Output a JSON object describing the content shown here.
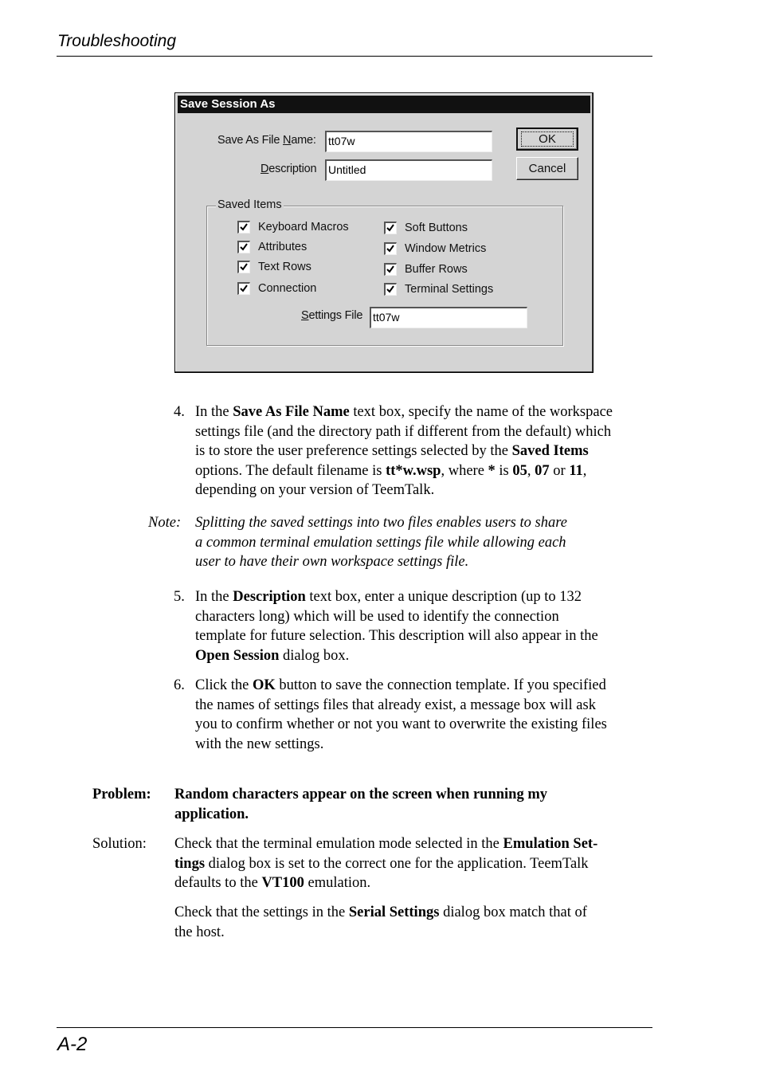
{
  "header": {
    "running_title": "Troubleshooting"
  },
  "footer": {
    "page_number": "A-2"
  },
  "dialog": {
    "title": "Save Session As",
    "file_name_label_pre": "Save As File ",
    "file_name_label_ul": "N",
    "file_name_label_post": "ame:",
    "file_name_value": "tt07w",
    "description_label_ul": "D",
    "description_label_post": "escription",
    "description_value": "Untitled",
    "ok_label": "OK",
    "cancel_label": "Cancel",
    "saved_items_legend": "Saved Items",
    "checkboxes": [
      {
        "label": "Keyboard Macros",
        "checked": true
      },
      {
        "label": "Attributes",
        "checked": true
      },
      {
        "label": "Text Rows",
        "checked": true
      },
      {
        "label": "Connection",
        "checked": true
      },
      {
        "label": "Soft Buttons",
        "checked": true
      },
      {
        "label": "Window Metrics",
        "checked": true
      },
      {
        "label": "Buffer Rows",
        "checked": true
      },
      {
        "label": "Terminal Settings",
        "checked": true
      }
    ],
    "settings_file_label_ul": "S",
    "settings_file_label_post": "ettings File",
    "settings_file_value": "tt07w"
  },
  "steps": {
    "step4": {
      "number": "4.",
      "t1": "In the ",
      "b1": "Save As File Name",
      "t2": " text box, specify the name of the workspace",
      "line2": "settings file (and the directory path if different from the default) which",
      "t3": "is to store the user preference settings selected by the ",
      "b2": "Saved Items",
      "t4": "options. The default filename is ",
      "b3": "tt*w.wsp",
      "t5": ", where ",
      "b4": "*",
      "t6": " is ",
      "b5": "05",
      "t7": ", ",
      "b6": "07",
      "t8": " or ",
      "b7": "11",
      "t9": ",",
      "line5": "depending on your version of TeemTalk."
    },
    "note": {
      "label": "Note:",
      "line1": "Splitting the saved settings into two files enables users to share",
      "line2": "a common terminal emulation settings file while allowing each",
      "line3": "user to have their own workspace settings file."
    },
    "step5": {
      "number": "5.",
      "t1": "In the ",
      "b1": "Description",
      "t2": " text box, enter a unique description (up to 132",
      "line2": "characters long) which will be used to identify the connection",
      "line3": "template for future selection. This description will also appear in the",
      "b2": "Open Session",
      "t3": " dialog box."
    },
    "step6": {
      "number": "6.",
      "t1": "Click the ",
      "b1": "OK",
      "t2": " button to save the connection template. If you specified",
      "line2": "the names of settings files that already exist, a message box will ask",
      "line3": "you to confirm whether or not you want to overwrite the existing files",
      "line4": "with the new settings."
    }
  },
  "problem": {
    "label": "Problem:",
    "line1": "Random characters appear on the screen when running my",
    "line2": "application."
  },
  "solution": {
    "label": "Solution:",
    "t1": "Check that the terminal emulation mode selected in the ",
    "b1": "Emulation Set-",
    "b2": "tings",
    "t2": " dialog box is set to the correct one for the application. TeemTalk",
    "t3": "defaults to the ",
    "b3": "VT100",
    "t4": " emulation.",
    "p2_t1": "Check that the settings in the ",
    "p2_b1": "Serial Settings",
    "p2_t2": " dialog box match that of",
    "p2_line2": "the host."
  }
}
